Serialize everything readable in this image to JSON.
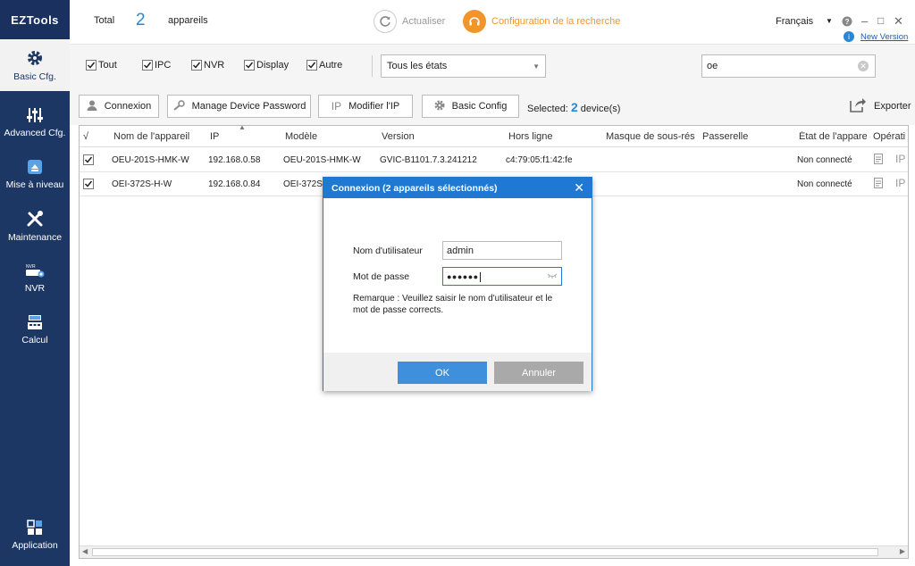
{
  "app": {
    "logo": "EZTools"
  },
  "sidebar": {
    "items": [
      {
        "label": "Basic Cfg.",
        "icon": "gear-icon",
        "active": true
      },
      {
        "label": "Advanced Cfg.",
        "icon": "sliders-icon",
        "active": false
      },
      {
        "label": "Mise à niveau",
        "icon": "upgrade-icon",
        "active": false
      },
      {
        "label": "Maintenance",
        "icon": "tools-icon",
        "active": false
      },
      {
        "label": "NVR",
        "icon": "nvr-icon",
        "active": false
      },
      {
        "label": "Calcul",
        "icon": "calculator-icon",
        "active": false
      },
      {
        "label": "Application",
        "icon": "apps-grid-icon",
        "active": false
      }
    ]
  },
  "header": {
    "total_label": "Total",
    "count": "2",
    "devices_label": "appareils",
    "refresh_label": "Actualiser",
    "search_config_label": "Configuration de la recherche",
    "language": "Français",
    "new_version": "New Version"
  },
  "filters": {
    "checkboxes": [
      {
        "label": "Tout",
        "checked": true
      },
      {
        "label": "IPC",
        "checked": true
      },
      {
        "label": "NVR",
        "checked": true
      },
      {
        "label": "Display",
        "checked": true
      },
      {
        "label": "Autre",
        "checked": true
      }
    ],
    "state_select": "Tous les états",
    "search_value": "oe"
  },
  "actions": {
    "connexion": "Connexion",
    "manage_password": "Manage Device Password",
    "modify_ip": "Modifier l'IP",
    "basic_config": "Basic Config",
    "selected_prefix": "Selected:",
    "selected_count": "2",
    "selected_suffix": "device(s)",
    "export": "Exporter"
  },
  "table": {
    "columns": [
      "√",
      "Nom de l'appareil",
      "IP",
      "Modèle",
      "Version",
      "Hors ligne",
      "Masque de sous-rés",
      "Passerelle",
      "État de l'appare",
      "Opérati"
    ],
    "rows": [
      {
        "checked": true,
        "name": "OEU-201S-HMK-W",
        "ip": "192.168.0.58",
        "model": "OEU-201S-HMK-W",
        "version": "GVIC-B1101.7.3.241212",
        "offline": "c4:79:05:f1:42:fe",
        "mask": "",
        "gateway": "",
        "state": "Non connecté",
        "op": "IP"
      },
      {
        "checked": true,
        "name": "OEI-372S-H-W",
        "ip": "192.168.0.84",
        "model": "OEI-372S-",
        "version": "",
        "offline": "",
        "mask": "",
        "gateway": "",
        "state": "Non connecté",
        "op": "IP"
      }
    ]
  },
  "modal": {
    "title": "Connexion (2 appareils sélectionnés)",
    "username_label": "Nom d'utilisateur",
    "username_value": "admin",
    "password_label": "Mot de passe",
    "password_value": "●●●●●●",
    "note": "Remarque : Veuillez saisir le nom d'utilisateur et le mot de passe corrects.",
    "ok": "OK",
    "cancel": "Annuler"
  },
  "colors": {
    "sidebar": "#1d3764",
    "accent": "#2b86d3",
    "orange": "#f1952b",
    "modal_blue": "#1f78d1",
    "ok_button": "#3e8fdc",
    "cancel_button": "#a9a9a9"
  }
}
